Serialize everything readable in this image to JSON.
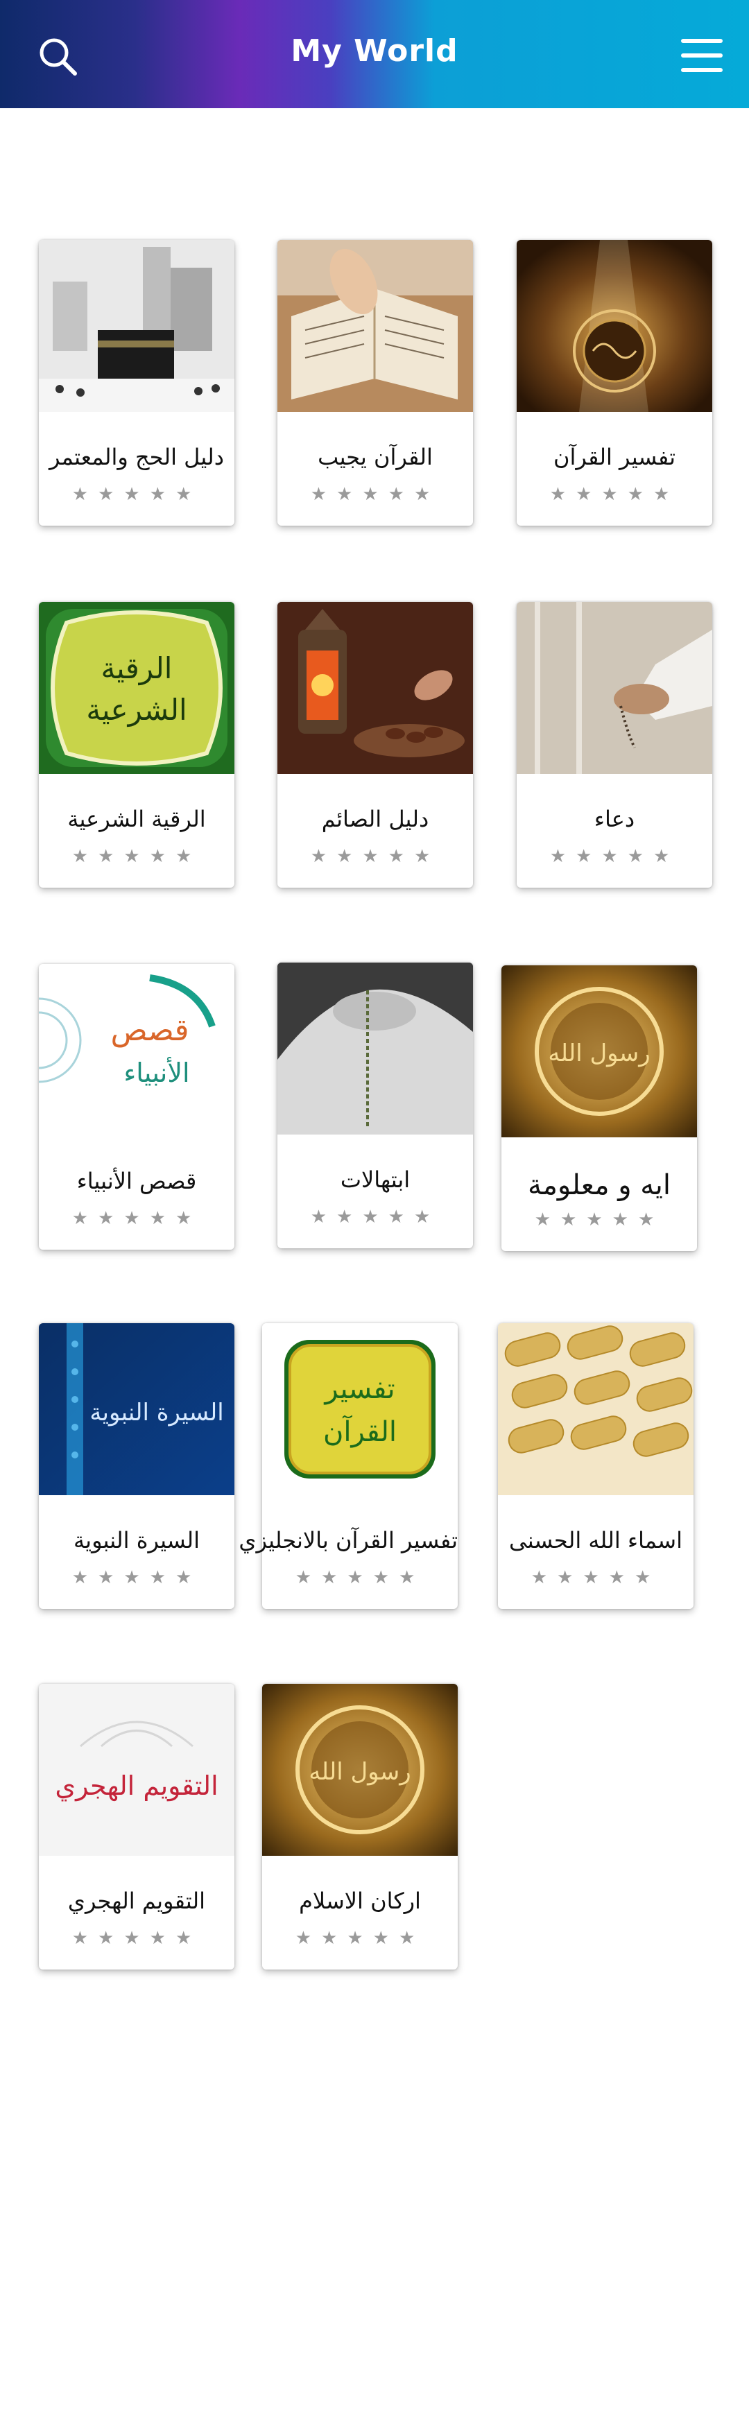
{
  "header": {
    "title": "My World",
    "search_icon": "search-icon",
    "menu_icon": "hamburger-menu-icon"
  },
  "accent": "#05aad8",
  "items": [
    {
      "title": "تفسير القرآن",
      "rating": 0
    },
    {
      "title": "القرآن يجيب",
      "rating": 0
    },
    {
      "title": "دليل الحج والمعتمر",
      "rating": 0
    },
    {
      "title": "دعاء",
      "rating": 0
    },
    {
      "title": "دليل الصائم",
      "rating": 0
    },
    {
      "title": "الرقية الشرعية",
      "rating": 0
    },
    {
      "title": "ايه و معلومة",
      "rating": 0
    },
    {
      "title": "ابتهالات",
      "rating": 0
    },
    {
      "title": "قصص الأنبياء",
      "rating": 0
    },
    {
      "title": "اسماء الله الحسنى",
      "rating": 0
    },
    {
      "title": "تفسير القرآن بالانجليزي",
      "rating": 0
    },
    {
      "title": "السيرة النبوية",
      "rating": 0
    },
    {
      "title": "اركان الاسلام",
      "rating": 0
    },
    {
      "title": "التقويم الهجري",
      "rating": 0
    }
  ],
  "thumb_text": {
    "roqia_1": "الرقية",
    "roqia_2": "الشرعية",
    "qasas_1": "قصص",
    "qasas_2": "الأنبياء",
    "rasool": "رسول الله",
    "seerah": "السيرة النبوية",
    "tafsir_1": "تفسير",
    "tafsir_2": "القرآن",
    "hijri": "التقويم الهجري"
  },
  "stars": "★★★★★"
}
